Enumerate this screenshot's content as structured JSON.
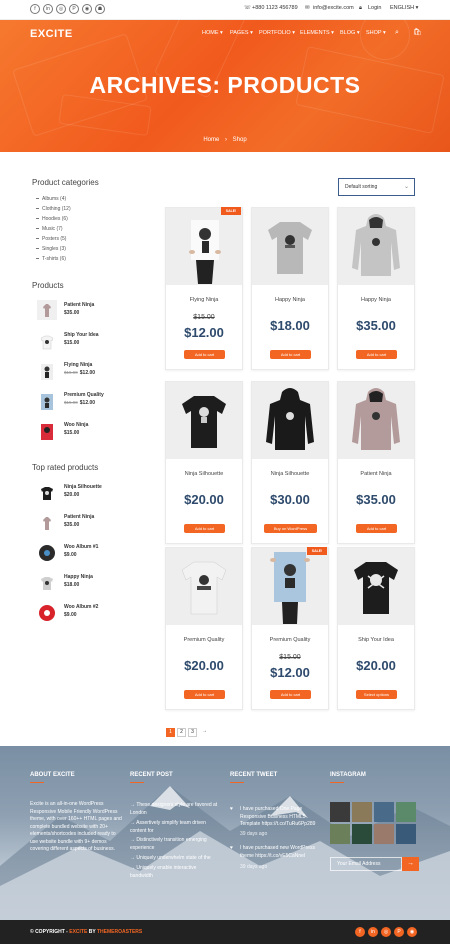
{
  "topbar": {
    "social": [
      "f",
      "in",
      "◎",
      "P",
      "◉",
      "☗"
    ],
    "phone": "+880 1123 456789",
    "email": "info@excite.com",
    "login": "Login",
    "language": "ENGLISH"
  },
  "header": {
    "logo": "EXCITE",
    "nav": [
      "HOME",
      "PAGES",
      "PORTFOLIO",
      "ELEMENTS",
      "BLOG",
      "SHOP"
    ],
    "title": "ARCHIVES: PRODUCTS",
    "breadcrumb": {
      "home": "Home",
      "sep": "›",
      "current": "Shop"
    }
  },
  "sidebar": {
    "categories_title": "Product categories",
    "categories": [
      "Albums (4)",
      "Clothing (12)",
      "Hoodies (6)",
      "Music (7)",
      "Posters (5)",
      "Singles (3)",
      "T-shirts (6)"
    ],
    "products_title": "Products",
    "products": [
      {
        "name": "Patient Ninja",
        "old": "",
        "price": "$35.00"
      },
      {
        "name": "Ship Your Idea",
        "old": "",
        "price": "$15.00"
      },
      {
        "name": "Flying Ninja",
        "old": "$15.00",
        "price": "$12.00"
      },
      {
        "name": "Premium Quality",
        "old": "$15.00",
        "price": "$12.00"
      },
      {
        "name": "Woo Ninja",
        "old": "",
        "price": "$15.00"
      }
    ],
    "top_rated_title": "Top rated products",
    "top_rated": [
      {
        "name": "Ninja Silhouette",
        "price": "$20.00"
      },
      {
        "name": "Patient Ninja",
        "price": "$35.00"
      },
      {
        "name": "Woo Album #1",
        "price": "$9.00"
      },
      {
        "name": "Happy Ninja",
        "price": "$18.00"
      },
      {
        "name": "Woo Album #2",
        "price": "$9.00"
      }
    ]
  },
  "sorting": {
    "label": "Default sorting"
  },
  "products": [
    {
      "name": "Flying Ninja",
      "old": "$15.00",
      "price": "$12.00",
      "sale": "SALE!",
      "button": "Add to cart",
      "kind": "poster"
    },
    {
      "name": "Happy Ninja",
      "old": "",
      "price": "$18.00",
      "sale": "",
      "button": "Add to cart",
      "kind": "tee-grey"
    },
    {
      "name": "Happy Ninja",
      "old": "",
      "price": "$35.00",
      "sale": "",
      "button": "Add to cart",
      "kind": "hoodie-grey"
    },
    {
      "name": "Ninja Silhouette",
      "old": "",
      "price": "$20.00",
      "sale": "",
      "button": "Add to cart",
      "kind": "tee-black"
    },
    {
      "name": "Ninja Silhouette",
      "old": "",
      "price": "$30.00",
      "sale": "",
      "button": "Buy on WordPress",
      "kind": "hoodie-black"
    },
    {
      "name": "Patient Ninja",
      "old": "",
      "price": "$35.00",
      "sale": "",
      "button": "Add to cart",
      "kind": "hoodie-pink"
    },
    {
      "name": "Premium Quality",
      "old": "",
      "price": "$20.00",
      "sale": "",
      "button": "Add to cart",
      "kind": "tee-white"
    },
    {
      "name": "Premium Quality",
      "old": "$15.00",
      "price": "$12.00",
      "sale": "SALE!",
      "button": "Add to cart",
      "kind": "poster-blue"
    },
    {
      "name": "Ship Your Idea",
      "old": "",
      "price": "$20.00",
      "sale": "",
      "button": "Select options",
      "kind": "tee-black2"
    }
  ],
  "pagination": [
    "1",
    "2",
    "3",
    "→"
  ],
  "footer": {
    "about_title": "ABOUT EXCITE",
    "about_text": "Excite is an all-in-one WordPress Responsive Mobile Friendly WordPress theme, with over 160++ HTML pages and complete bundled website with 20+ elements/shortcodes included ready to use website bundle with 9+ demos covering different aspects of business.",
    "recent_title": "RECENT POST",
    "recent_posts": [
      "These designers style are favored at London",
      "Assertively simplify team driven content for",
      "Distinctively transition emerging experience",
      "Uniquely underwhelm state of the",
      "Uniquely enable interactive bandwidth"
    ],
    "tweet_title": "RECENT TWEET",
    "tweets": [
      {
        "text": "I have purchased One Page Responsive Business HTML5 Template https://t.co/TuRu6Pp289",
        "time": "39 days ago"
      },
      {
        "text": "I have purchased new WordPress theme https://t.co/vE5CaNnel",
        "time": "39 days ago"
      }
    ],
    "instagram_title": "INSTAGRAM",
    "email_placeholder": "Your Email Address",
    "send": "→"
  },
  "bottom": {
    "copyright_pre": "© COPYRIGHT - ",
    "copyright_brand": "EXCITE",
    "copyright_mid": " BY ",
    "copyright_author": "THEMEROASTERS",
    "social": [
      "f",
      "in",
      "◎",
      "P",
      "◉"
    ]
  },
  "colors": {
    "accent": "#f26522",
    "price": "#2e4a6c",
    "dark": "#222222"
  }
}
